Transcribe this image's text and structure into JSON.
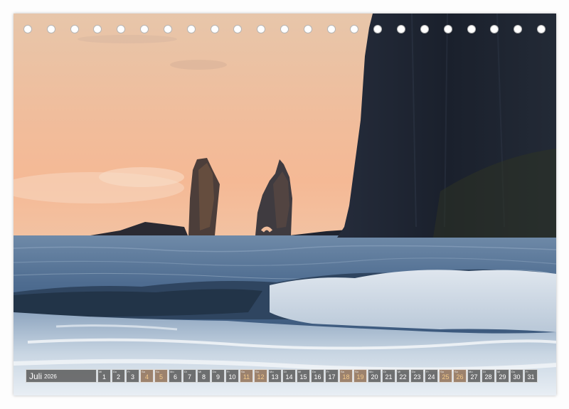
{
  "calendar": {
    "month": "Juli",
    "year": "2026",
    "days": [
      {
        "n": "1",
        "dw": "Mi",
        "weekend": false
      },
      {
        "n": "2",
        "dw": "Do",
        "weekend": false
      },
      {
        "n": "3",
        "dw": "Fr",
        "weekend": false
      },
      {
        "n": "4",
        "dw": "Sa",
        "weekend": true
      },
      {
        "n": "5",
        "dw": "So",
        "weekend": true
      },
      {
        "n": "6",
        "dw": "Mo",
        "weekend": false
      },
      {
        "n": "7",
        "dw": "Di",
        "weekend": false
      },
      {
        "n": "8",
        "dw": "Mi",
        "weekend": false
      },
      {
        "n": "9",
        "dw": "Do",
        "weekend": false
      },
      {
        "n": "10",
        "dw": "Fr",
        "weekend": false
      },
      {
        "n": "11",
        "dw": "Sa",
        "weekend": true
      },
      {
        "n": "12",
        "dw": "So",
        "weekend": true
      },
      {
        "n": "13",
        "dw": "Mo",
        "weekend": false
      },
      {
        "n": "14",
        "dw": "Di",
        "weekend": false
      },
      {
        "n": "15",
        "dw": "Mi",
        "weekend": false
      },
      {
        "n": "16",
        "dw": "Do",
        "weekend": false
      },
      {
        "n": "17",
        "dw": "Fr",
        "weekend": false
      },
      {
        "n": "18",
        "dw": "Sa",
        "weekend": true
      },
      {
        "n": "19",
        "dw": "So",
        "weekend": true
      },
      {
        "n": "20",
        "dw": "Mo",
        "weekend": false
      },
      {
        "n": "21",
        "dw": "Di",
        "weekend": false
      },
      {
        "n": "22",
        "dw": "Mi",
        "weekend": false
      },
      {
        "n": "23",
        "dw": "Do",
        "weekend": false
      },
      {
        "n": "24",
        "dw": "Fr",
        "weekend": false
      },
      {
        "n": "25",
        "dw": "Sa",
        "weekend": true
      },
      {
        "n": "26",
        "dw": "So",
        "weekend": true
      },
      {
        "n": "27",
        "dw": "Mo",
        "weekend": false
      },
      {
        "n": "28",
        "dw": "Di",
        "weekend": false
      },
      {
        "n": "29",
        "dw": "Mi",
        "weekend": false
      },
      {
        "n": "30",
        "dw": "Do",
        "weekend": false
      },
      {
        "n": "31",
        "dw": "Fr",
        "weekend": false
      }
    ]
  },
  "binding": {
    "hole_count": 23
  },
  "colors": {
    "sky_top": "#e9c7a9",
    "sky_bottom": "#f1b48f",
    "sea": "#4f6f93",
    "cliff": "#1c2230",
    "weekend_text": "#f2c88a"
  }
}
